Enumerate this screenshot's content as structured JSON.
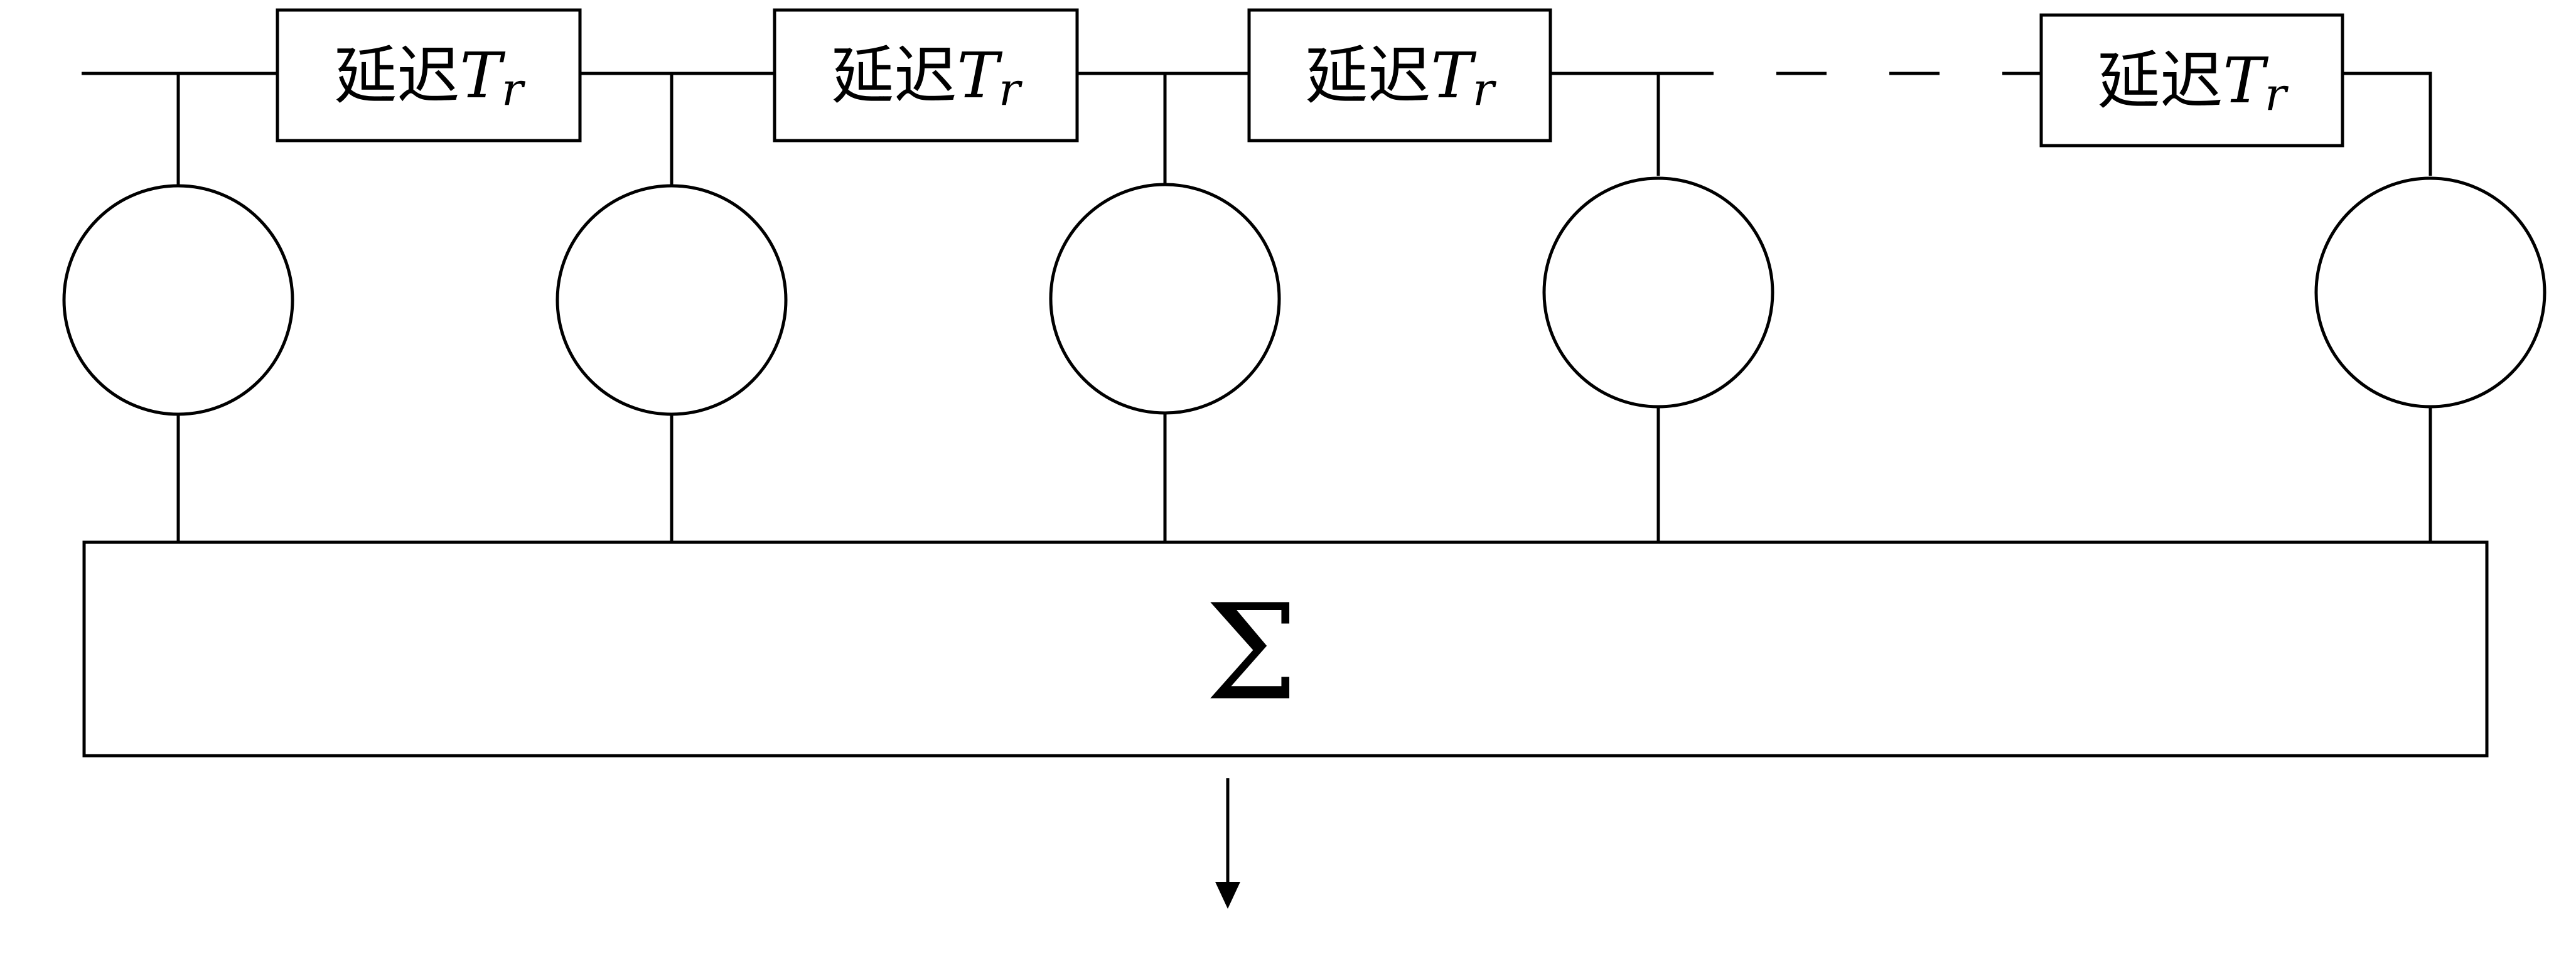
{
  "delay_blocks": [
    {
      "prefix": "延迟",
      "symbol": "T",
      "subscript": "r"
    },
    {
      "prefix": "延迟",
      "symbol": "T",
      "subscript": "r"
    },
    {
      "prefix": "延迟",
      "symbol": "T",
      "subscript": "r"
    },
    {
      "prefix": "延迟",
      "symbol": "T",
      "subscript": "r"
    }
  ],
  "summation": {
    "symbol": "Σ"
  },
  "tap_count": 5,
  "colors": {
    "stroke": "#000000",
    "background": "#ffffff"
  }
}
